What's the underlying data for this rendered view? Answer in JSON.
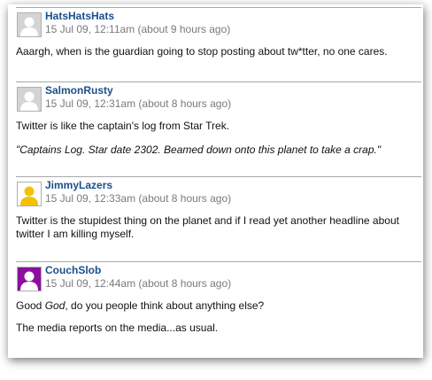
{
  "comments": [
    {
      "username": "HatsHatsHats",
      "timestamp": "15 Jul 09, 12:11am (about 9 hours ago)",
      "avatar_color": "#d4d4d4",
      "paragraphs": [
        "Aaargh, when is the guardian going to stop posting about tw*tter, no one cares."
      ]
    },
    {
      "username": "SalmonRusty",
      "timestamp": "15 Jul 09, 12:31am (about 8 hours ago)",
      "avatar_color": "#d4d4d4",
      "paragraphs": [
        "Twitter is like the captain's log from Star Trek.",
        "\"Captains Log. Star date 2302. Beamed down onto this planet to take a crap.\""
      ]
    },
    {
      "username": "JimmyLazers",
      "timestamp": "15 Jul 09, 12:33am (about 8 hours ago)",
      "avatar_color": "#f2c200",
      "paragraphs": [
        "Twitter is the stupidest thing on the planet and if I read yet another headline about",
        "twitter I am killing myself."
      ]
    },
    {
      "username": "CouchSlob",
      "timestamp": "15 Jul 09, 12:44am (about 8 hours ago)",
      "avatar_color": "#8c0f9c",
      "paragraphs": [
        {
          "before": "Good ",
          "emphasis": "God",
          "after": ", do you people think about anything else?"
        },
        "The media reports on the media...as usual."
      ]
    }
  ]
}
